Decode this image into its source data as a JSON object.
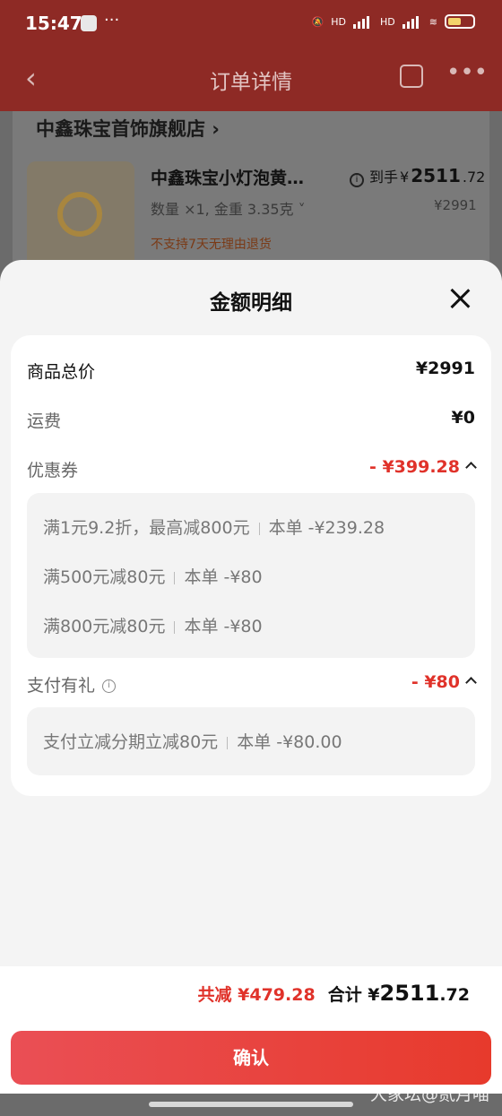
{
  "status_bar": {
    "time": "15:47",
    "hd1": "HD",
    "hd2": "HD"
  },
  "nav": {
    "title": "订单详情"
  },
  "shop": {
    "name": "中鑫珠宝首饰旗舰店 ›"
  },
  "product": {
    "title": "中鑫珠宝小灯泡黄…",
    "pay_label": "到手",
    "pay_currency": "¥",
    "pay_int": "2511",
    "pay_dec": ".72",
    "spec": "数量 ×1, 金重 3.35克 ˅",
    "original_price": "¥2991",
    "note": "不支持7天无理由退货"
  },
  "sheet": {
    "title": "金额明细",
    "rows": {
      "goods_total": {
        "label": "商品总价",
        "value": "¥2991"
      },
      "shipping": {
        "label": "运费",
        "value": "¥0"
      },
      "coupon": {
        "label": "优惠券",
        "value": "- ¥399.28"
      },
      "payment_gift": {
        "label": "支付有礼",
        "value": "- ¥80"
      }
    },
    "coupons": [
      {
        "desc": "满1元9.2折，最高减800元",
        "amount": "本单 -¥239.28"
      },
      {
        "desc": "满500元减80元",
        "amount": "本单 -¥80"
      },
      {
        "desc": "满800元减80元",
        "amount": "本单 -¥80"
      }
    ],
    "payment_items": [
      {
        "desc": "支付立减分期立减80元",
        "amount": "本单 -¥80.00"
      }
    ],
    "footer": {
      "reduced": "共减 ¥479.28",
      "total_label": "合计 ¥",
      "total_int": "2511",
      "total_dec": ".72"
    },
    "confirm_label": "确认"
  },
  "watermark": "大家坛@贰月喵",
  "colors": {
    "accent_red": "#e0322a",
    "button_gradient_start": "#ea4f55",
    "button_gradient_end": "#e73a2c"
  }
}
